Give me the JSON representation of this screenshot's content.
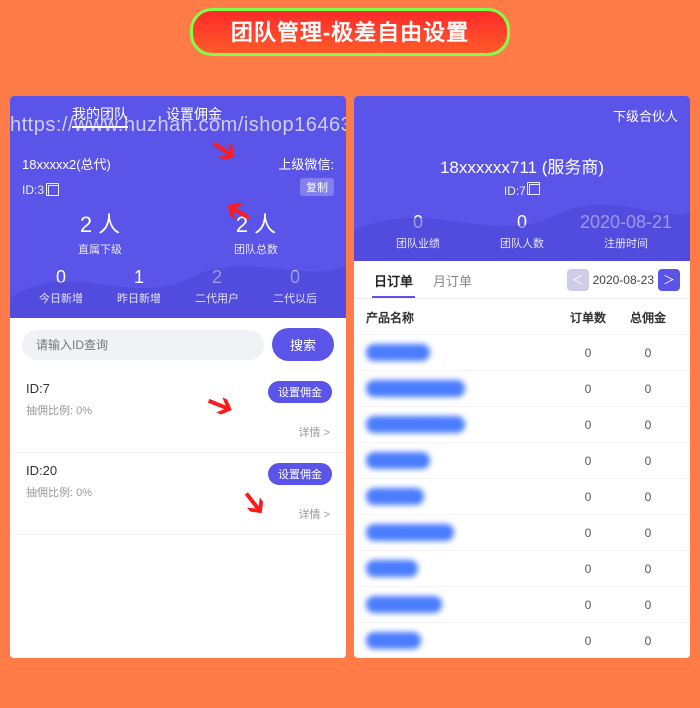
{
  "banner": "团队管理-极差自由设置",
  "watermark": "https://www.huzhan.com/ishop16463",
  "left": {
    "tabs": [
      "我的团队",
      "设置佣金"
    ],
    "name": "18xxxxx2(总代)",
    "wechat_label": "上级微信:",
    "copy": "复制",
    "id": "ID:3",
    "big": [
      {
        "num": "2 人",
        "lbl": "直属下级"
      },
      {
        "num": "2 人",
        "lbl": "团队总数"
      }
    ],
    "stat4": [
      {
        "n": "0",
        "l": "今日新增"
      },
      {
        "n": "1",
        "l": "昨日新增"
      },
      {
        "n": "2",
        "l": "二代用户"
      },
      {
        "n": "0",
        "l": "二代以后"
      }
    ],
    "search_placeholder": "请输入ID查询",
    "search_btn": "搜索",
    "members": [
      {
        "id": "ID:7",
        "rate": "抽佣比例: 0%",
        "pill": "设置佣金",
        "detail": "详情 >"
      },
      {
        "id": "ID:20",
        "rate": "抽佣比例: 0%",
        "pill": "设置佣金",
        "detail": "详情 >"
      }
    ]
  },
  "right": {
    "linktxt": "下级合伙人",
    "name": "18xxxxxx711 (服务商)",
    "id": "ID:7",
    "stat3": [
      {
        "n": "0",
        "l": "团队业绩"
      },
      {
        "n": "0",
        "l": "团队人数"
      },
      {
        "n": "2020-08-21",
        "l": "注册时间"
      }
    ],
    "tabs": [
      "日订单",
      "月订单"
    ],
    "date": "2020-08-23",
    "thead": {
      "c1": "产品名称",
      "c2": "订单数",
      "c3": "总佣金"
    },
    "rows": [
      {
        "name": "支xx实名",
        "orders": "0",
        "comm": "0"
      },
      {
        "name": "陌xxxx (限女性)",
        "orders": "0",
        "comm": "0"
      },
      {
        "name": "陌xxxx (限男性)",
        "orders": "0",
        "comm": "0"
      },
      {
        "name": "支xx核销",
        "orders": "0",
        "comm": "0"
      },
      {
        "name": "淘xxxxx",
        "orders": "0",
        "comm": "0"
      },
      {
        "name": "邮xx银行xx卡",
        "orders": "0",
        "comm": "0"
      },
      {
        "name": "xx实名",
        "orders": "0",
        "comm": "0"
      },
      {
        "name": "本xx号码版",
        "orders": "0",
        "comm": "0"
      },
      {
        "name": "3Dxx版",
        "orders": "0",
        "comm": "0"
      }
    ]
  }
}
